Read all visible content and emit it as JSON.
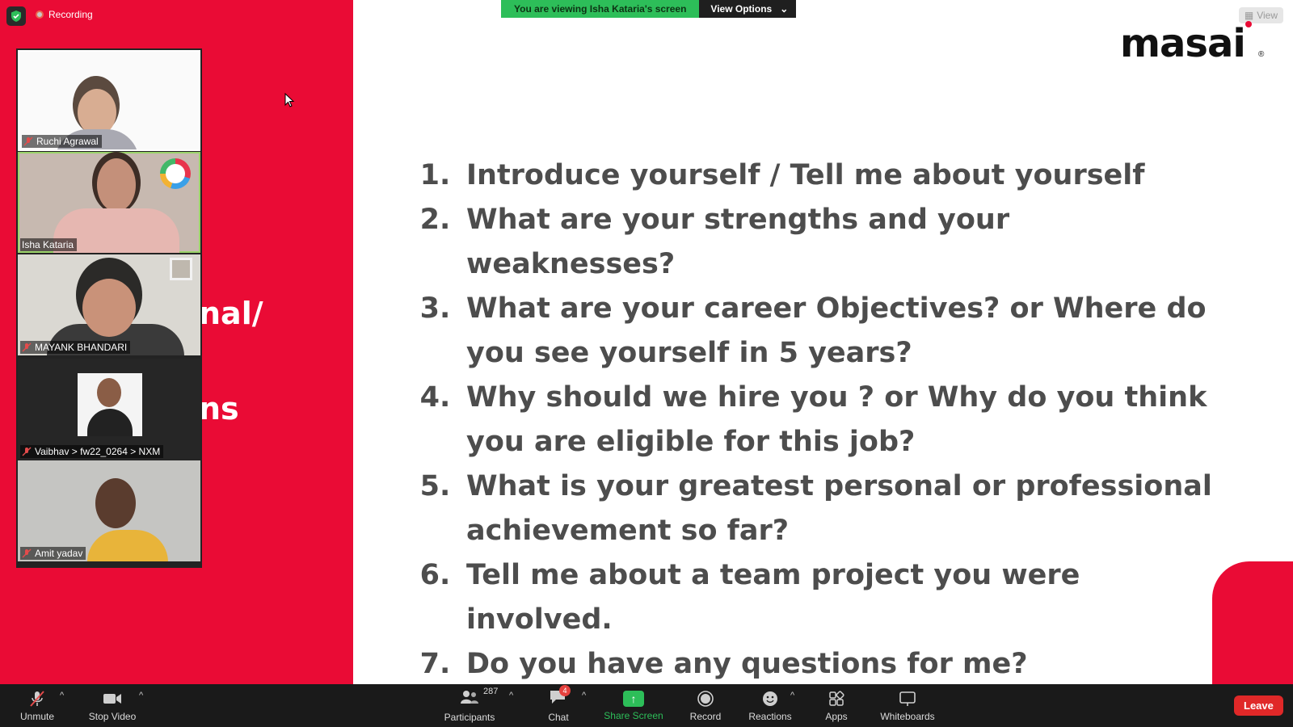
{
  "recording": {
    "label": "Recording"
  },
  "share_banner": {
    "viewing_text": "You are viewing Isha Kataria's screen",
    "options_label": "View Options",
    "view_label": "View"
  },
  "participants": [
    {
      "name": "Ruchi Agrawal"
    },
    {
      "name": "Isha Kataria"
    },
    {
      "name": "MAYANK BHANDARI"
    },
    {
      "name": "Vaibhav > fw22_0264 > NXM"
    },
    {
      "name": "Amit yadav"
    }
  ],
  "slide": {
    "logo": "masai",
    "logo_mark": "®",
    "left_partial_text": [
      "nal/",
      "ns"
    ],
    "questions": [
      {
        "num": "1.",
        "lines": [
          "Introduce yourself / Tell me about yourself"
        ]
      },
      {
        "num": "2.",
        "lines": [
          "What are your strengths and your weaknesses?"
        ]
      },
      {
        "num": "3.",
        "lines": [
          "What are your career Objectives? or Where do",
          "you see yourself in 5 years?"
        ]
      },
      {
        "num": "4.",
        "lines": [
          "Why should we hire you ? or Why do you think",
          "you are eligible for this job?"
        ]
      },
      {
        "num": "5.",
        "lines": [
          "What is your greatest personal or professional",
          "achievement so far?"
        ]
      },
      {
        "num": "6.",
        "lines": [
          "Tell me about a team project you were involved."
        ]
      },
      {
        "num": "7.",
        "lines": [
          "Do you have any questions for me?"
        ]
      }
    ]
  },
  "toolbar": {
    "unmute": "Unmute",
    "stop_video": "Stop Video",
    "participants": "Participants",
    "participants_count": "287",
    "chat": "Chat",
    "chat_badge": "4",
    "share_screen": "Share Screen",
    "record": "Record",
    "reactions": "Reactions",
    "apps": "Apps",
    "whiteboards": "Whiteboards",
    "leave": "Leave"
  },
  "colors": {
    "brand_red": "#ea0b35",
    "share_green": "#2dbe59",
    "leave_red": "#e02828",
    "text_gray": "#4d4d4d"
  }
}
